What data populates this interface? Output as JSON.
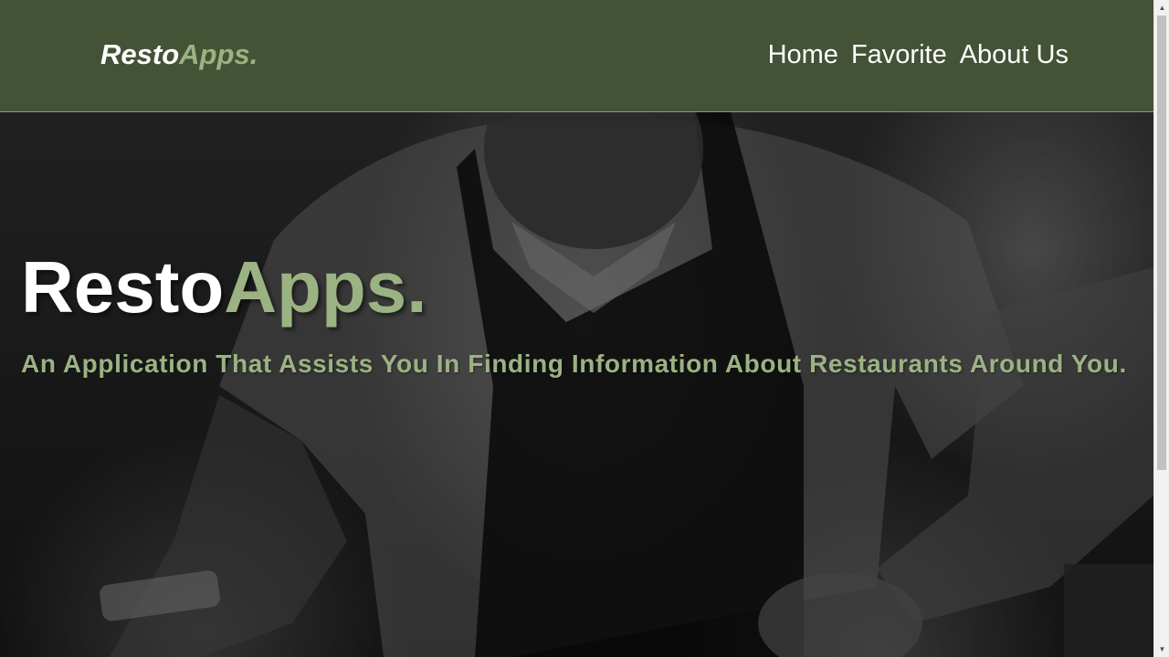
{
  "header": {
    "logo_main": "Resto",
    "logo_accent": "Apps."
  },
  "nav": {
    "items": [
      {
        "label": "Home"
      },
      {
        "label": "Favorite"
      },
      {
        "label": "About Us"
      }
    ]
  },
  "hero": {
    "title_main": "Resto",
    "title_accent": "Apps.",
    "subtitle": "An Application That Assists You In Finding Information About Restaurants Around You."
  },
  "colors": {
    "header_bg": "#445235",
    "accent": "#9bb283",
    "text": "#ffffff"
  },
  "scrollbar": {
    "up_icon": "▲",
    "down_icon": "▼"
  }
}
